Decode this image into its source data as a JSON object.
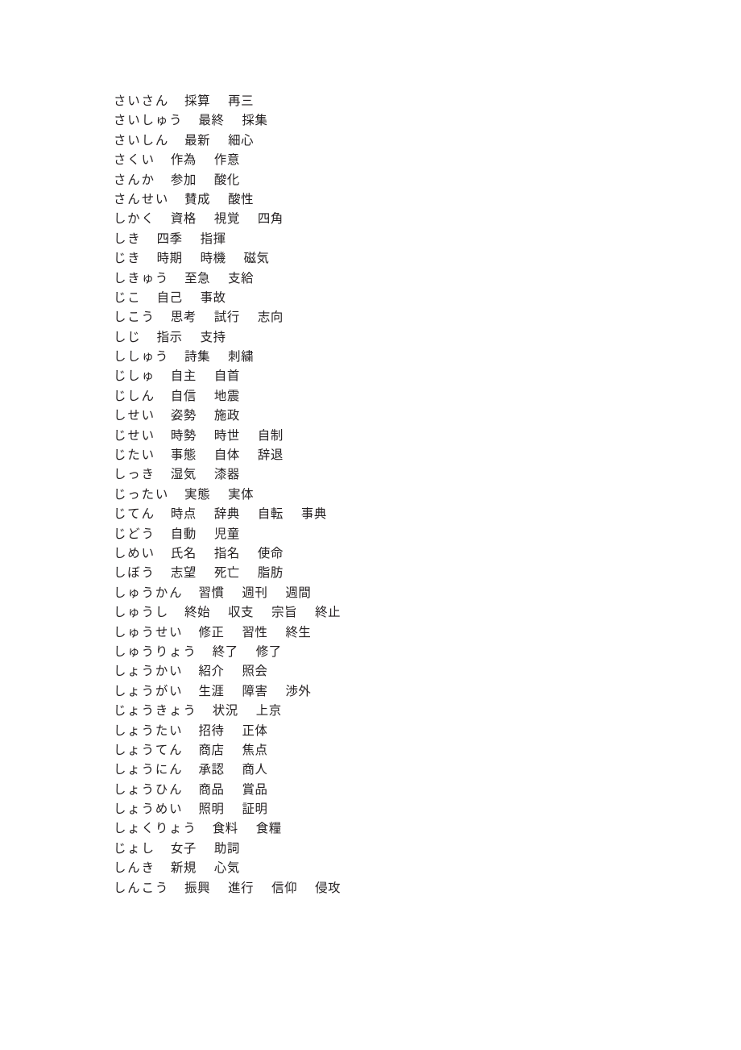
{
  "document": {
    "type": "word-list",
    "script": "japanese",
    "text_color": "#231f20",
    "background_color": "#ffffff",
    "description": "Japanese homophone (doukeigo) reference list: kana reading followed by kanji spellings"
  },
  "entries": [
    {
      "reading": "さいさん",
      "terms": [
        "採算",
        "再三"
      ]
    },
    {
      "reading": "さいしゅう",
      "terms": [
        "最終",
        "採集"
      ]
    },
    {
      "reading": "さいしん",
      "terms": [
        "最新",
        "細心"
      ]
    },
    {
      "reading": "さくい",
      "terms": [
        "作為",
        "作意"
      ]
    },
    {
      "reading": "さんか",
      "terms": [
        "参加",
        "酸化"
      ]
    },
    {
      "reading": "さんせい",
      "terms": [
        "賛成",
        "酸性"
      ]
    },
    {
      "reading": "しかく",
      "terms": [
        "資格",
        "視覚",
        "四角"
      ]
    },
    {
      "reading": "しき",
      "terms": [
        "四季",
        "指揮"
      ]
    },
    {
      "reading": "じき",
      "terms": [
        "時期",
        "時機",
        "磁気"
      ]
    },
    {
      "reading": "しきゅう",
      "terms": [
        "至急",
        "支給"
      ]
    },
    {
      "reading": "じこ",
      "terms": [
        "自己",
        "事故"
      ]
    },
    {
      "reading": "しこう",
      "terms": [
        "思考",
        "試行",
        "志向"
      ]
    },
    {
      "reading": "しじ",
      "terms": [
        "指示",
        "支持"
      ]
    },
    {
      "reading": "ししゅう",
      "terms": [
        "詩集",
        "刺繍"
      ]
    },
    {
      "reading": "じしゅ",
      "terms": [
        "自主",
        "自首"
      ]
    },
    {
      "reading": "じしん",
      "terms": [
        "自信",
        "地震"
      ]
    },
    {
      "reading": "しせい",
      "terms": [
        "姿勢",
        "施政"
      ]
    },
    {
      "reading": "じせい",
      "terms": [
        "時勢",
        "時世",
        "自制"
      ]
    },
    {
      "reading": "じたい",
      "terms": [
        "事態",
        "自体",
        "辞退"
      ]
    },
    {
      "reading": "しっき",
      "terms": [
        "湿気",
        "漆器"
      ]
    },
    {
      "reading": "じったい",
      "terms": [
        "実態",
        "実体"
      ]
    },
    {
      "reading": "じてん",
      "terms": [
        "時点",
        "辞典",
        "自転",
        "事典"
      ]
    },
    {
      "reading": "じどう",
      "terms": [
        "自動",
        "児童"
      ]
    },
    {
      "reading": "しめい",
      "terms": [
        "氏名",
        "指名",
        "使命"
      ]
    },
    {
      "reading": "しぼう",
      "terms": [
        "志望",
        "死亡",
        "脂肪"
      ]
    },
    {
      "reading": "しゅうかん",
      "terms": [
        "習慣",
        "週刊",
        "週間"
      ]
    },
    {
      "reading": "しゅうし",
      "terms": [
        "終始",
        "収支",
        "宗旨",
        "終止"
      ]
    },
    {
      "reading": "しゅうせい",
      "terms": [
        "修正",
        "習性",
        "終生"
      ]
    },
    {
      "reading": "しゅうりょう",
      "terms": [
        "終了",
        "修了"
      ]
    },
    {
      "reading": "しょうかい",
      "terms": [
        "紹介",
        "照会"
      ]
    },
    {
      "reading": "しょうがい",
      "terms": [
        "生涯",
        "障害",
        "渉外"
      ]
    },
    {
      "reading": "じょうきょう",
      "terms": [
        "状況",
        "上京"
      ]
    },
    {
      "reading": "しょうたい",
      "terms": [
        "招待",
        "正体"
      ]
    },
    {
      "reading": "しょうてん",
      "terms": [
        "商店",
        "焦点"
      ]
    },
    {
      "reading": "しょうにん",
      "terms": [
        "承認",
        "商人"
      ]
    },
    {
      "reading": "しょうひん",
      "terms": [
        "商品",
        "賞品"
      ]
    },
    {
      "reading": "しょうめい",
      "terms": [
        "照明",
        "証明"
      ]
    },
    {
      "reading": "しょくりょう",
      "terms": [
        "食料",
        "食糧"
      ]
    },
    {
      "reading": "じょし",
      "terms": [
        "女子",
        "助詞"
      ]
    },
    {
      "reading": "しんき",
      "terms": [
        "新規",
        "心気"
      ]
    },
    {
      "reading": "しんこう",
      "terms": [
        "振興",
        "進行",
        "信仰",
        "侵攻"
      ]
    }
  ]
}
